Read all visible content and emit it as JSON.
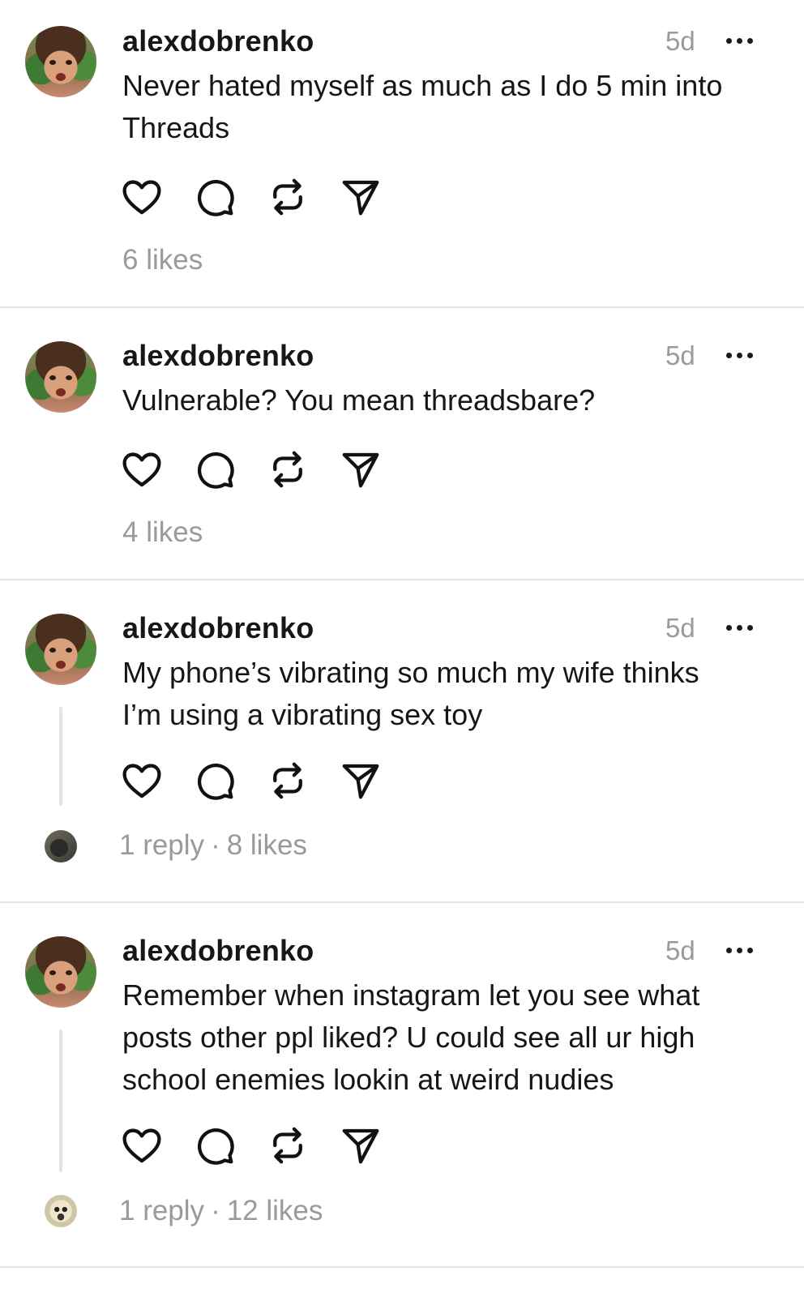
{
  "posts": [
    {
      "username": "alexdobrenko",
      "time": "5d",
      "text": "Never hated myself as much as I do 5 min into\nThreads",
      "likes": "6 likes",
      "replies": ""
    },
    {
      "username": "alexdobrenko",
      "time": "5d",
      "text": "Vulnerable? You mean threadsbare?",
      "likes": "4 likes",
      "replies": ""
    },
    {
      "username": "alexdobrenko",
      "time": "5d",
      "text": "My phone’s vibrating so much my wife thinks\nI’m using a vibrating sex toy",
      "likes": "8 likes",
      "replies": "1 reply"
    },
    {
      "username": "alexdobrenko",
      "time": "5d",
      "text": "Remember when instagram let you see what\nposts other ppl liked? U could see all ur high\nschool enemies lookin at weird nudies",
      "likes": "12 likes",
      "replies": "1 reply"
    }
  ],
  "meta_separator": "·",
  "icons": {
    "like": "heart-icon",
    "comment": "comment-icon",
    "repost": "repost-icon",
    "share": "send-icon",
    "more": "more-dots-icon"
  },
  "colors": {
    "text": "#161616",
    "muted": "#9a9a9a",
    "divider": "#e6e6e6",
    "thread_line": "#e3e3e3"
  }
}
